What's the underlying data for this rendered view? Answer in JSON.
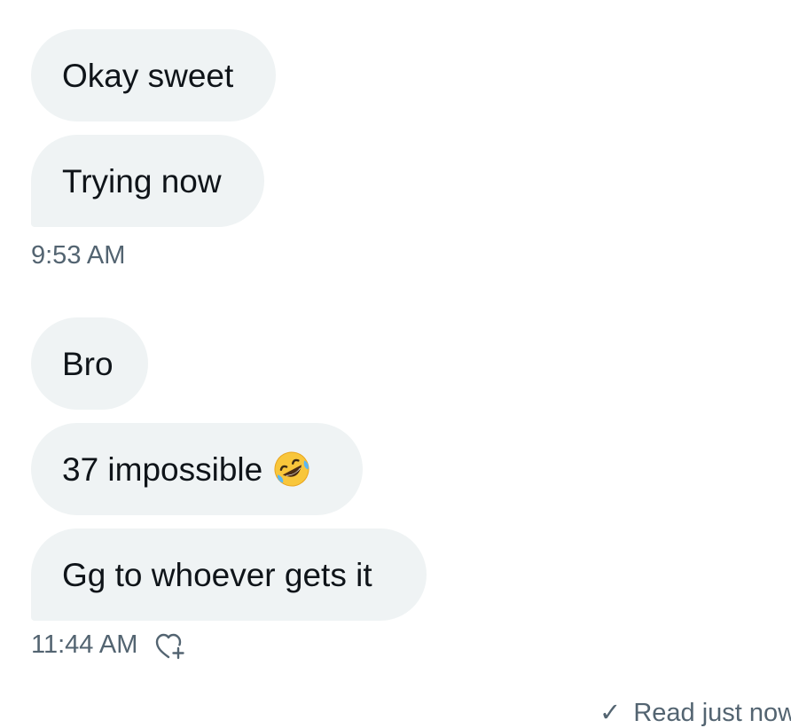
{
  "messages": [
    {
      "text": "Okay sweet"
    },
    {
      "text": "Trying now"
    },
    {
      "text": "Bro"
    },
    {
      "text": "37 impossible",
      "emoji": "rolling-on-floor-laughing-emoji"
    },
    {
      "text": "Gg to whoever gets it"
    }
  ],
  "timestamps": [
    "9:53 AM",
    "11:44 AM"
  ],
  "footer": {
    "seen_text": "Read just now"
  },
  "icons": {
    "reaction": "add-reaction-icon",
    "seen": "check-icon"
  },
  "colors": {
    "bubble_background": "#eff3f4",
    "message_text": "#0f1419",
    "timestamp_text": "#536471",
    "page_background": "#ffffff"
  }
}
